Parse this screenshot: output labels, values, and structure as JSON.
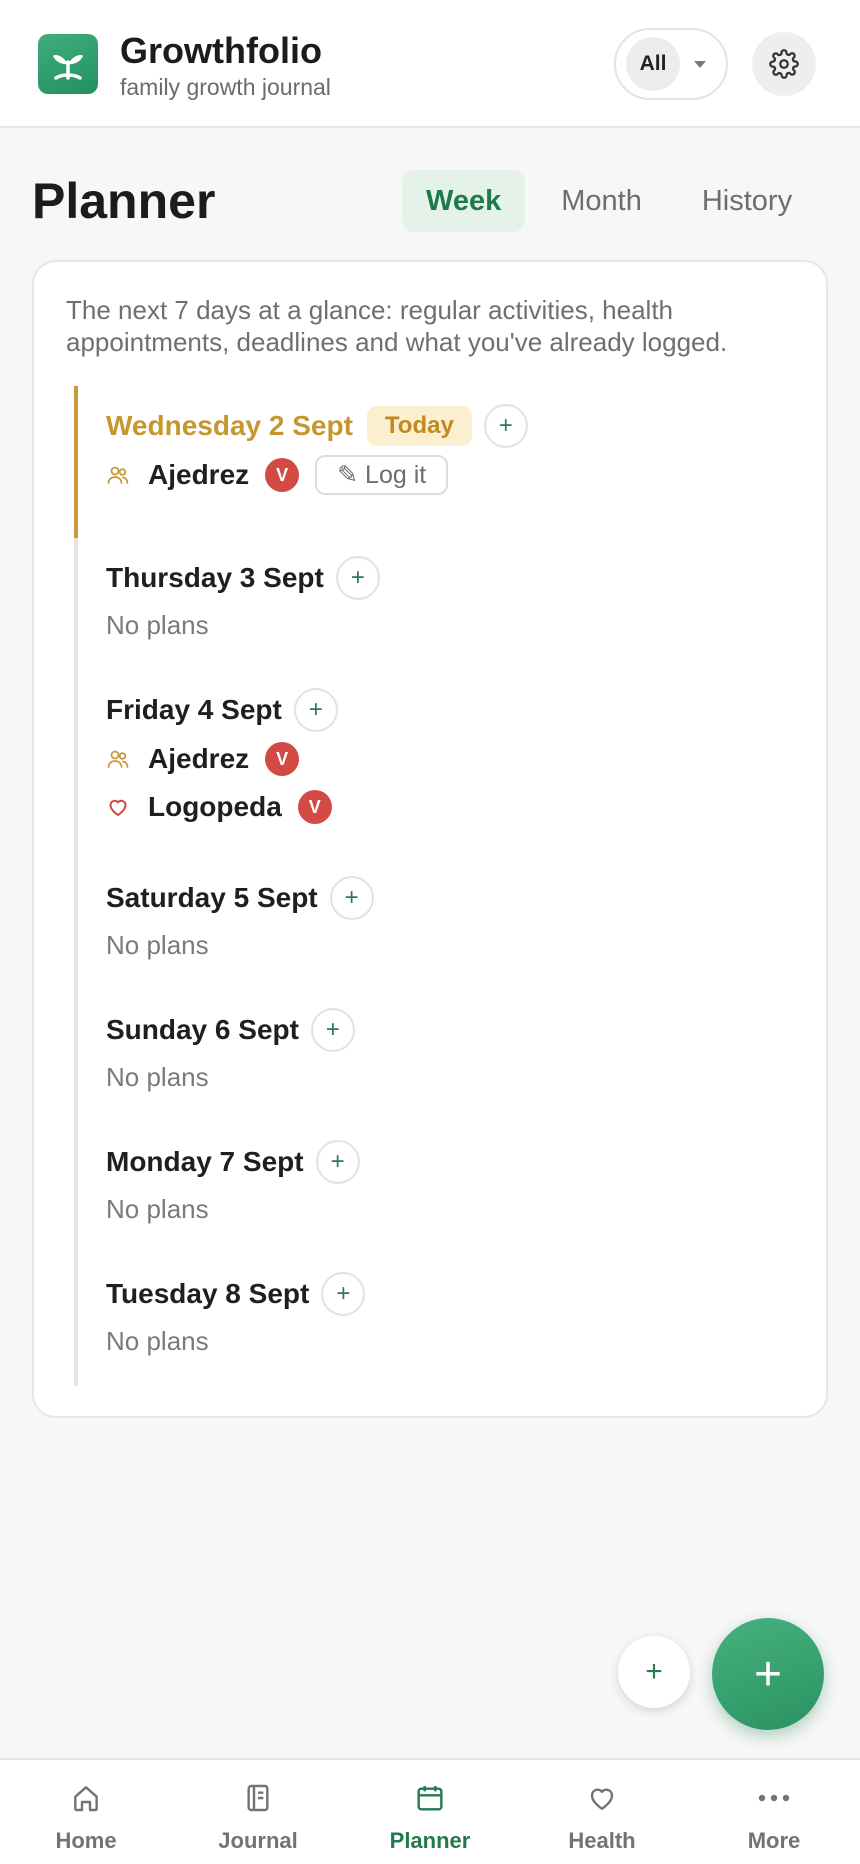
{
  "header": {
    "app_name": "Growthfolio",
    "tagline": "family growth journal",
    "child_filter": "All"
  },
  "page": {
    "title": "Planner",
    "tabs": [
      {
        "label": "Week",
        "active": true
      },
      {
        "label": "Month",
        "active": false
      },
      {
        "label": "History",
        "active": false
      }
    ]
  },
  "intro": "The next 7 days at a glance: regular activities, health appointments, deadlines and what you've already logged.",
  "days": [
    {
      "label": "Wednesday 2 Sept",
      "today_badge": "Today",
      "items": [
        {
          "name": "Ajedrez",
          "kind": "activity",
          "avatar": "V",
          "log_label": "✎ Log it"
        }
      ]
    },
    {
      "label": "Thursday 3 Sept",
      "empty": "No plans"
    },
    {
      "label": "Friday 4 Sept",
      "items": [
        {
          "name": "Ajedrez",
          "kind": "activity",
          "avatar": "V"
        },
        {
          "name": "Logopeda",
          "kind": "health",
          "avatar": "V"
        }
      ]
    },
    {
      "label": "Saturday 5 Sept",
      "empty": "No plans"
    },
    {
      "label": "Sunday 6 Sept",
      "empty": "No plans"
    },
    {
      "label": "Monday 7 Sept",
      "empty": "No plans"
    },
    {
      "label": "Tuesday 8 Sept",
      "empty": "No plans"
    }
  ],
  "add_symbol": "+",
  "nav": [
    {
      "label": "Home",
      "icon": "home-icon"
    },
    {
      "label": "Journal",
      "icon": "journal-icon"
    },
    {
      "label": "Planner",
      "icon": "calendar-icon",
      "active": true
    },
    {
      "label": "Health",
      "icon": "heart-icon"
    },
    {
      "label": "More",
      "icon": "more-icon"
    }
  ],
  "colors": {
    "brand": "#2f9e6a",
    "today": "#c6962f",
    "avatar": "#d24a43",
    "active_tab_bg": "#e5f2ea"
  }
}
